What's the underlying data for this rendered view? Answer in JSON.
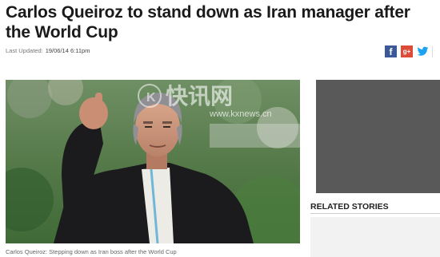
{
  "article": {
    "headline": "Carlos Queiroz to stand down as Iran manager after the World Cup",
    "last_updated_label": "Last Updated:",
    "last_updated_value": "19/06/14 6:11pm",
    "caption": "Carlos Queiroz: Stepping down as Iran boss after the World Cup"
  },
  "share": {
    "facebook_glyph": "f",
    "googleplus_glyph": "g+",
    "icons": [
      "facebook-icon",
      "google-plus-icon",
      "twitter-icon"
    ]
  },
  "watermark": {
    "chinese": "快讯网",
    "url": "www.kxnews.cn"
  },
  "sidebar": {
    "related_title": "RELATED STORIES"
  },
  "colors": {
    "facebook": "#3b5998",
    "googleplus": "#dd4b39",
    "twitter": "#1da1f2",
    "ad_box": "#595959"
  }
}
